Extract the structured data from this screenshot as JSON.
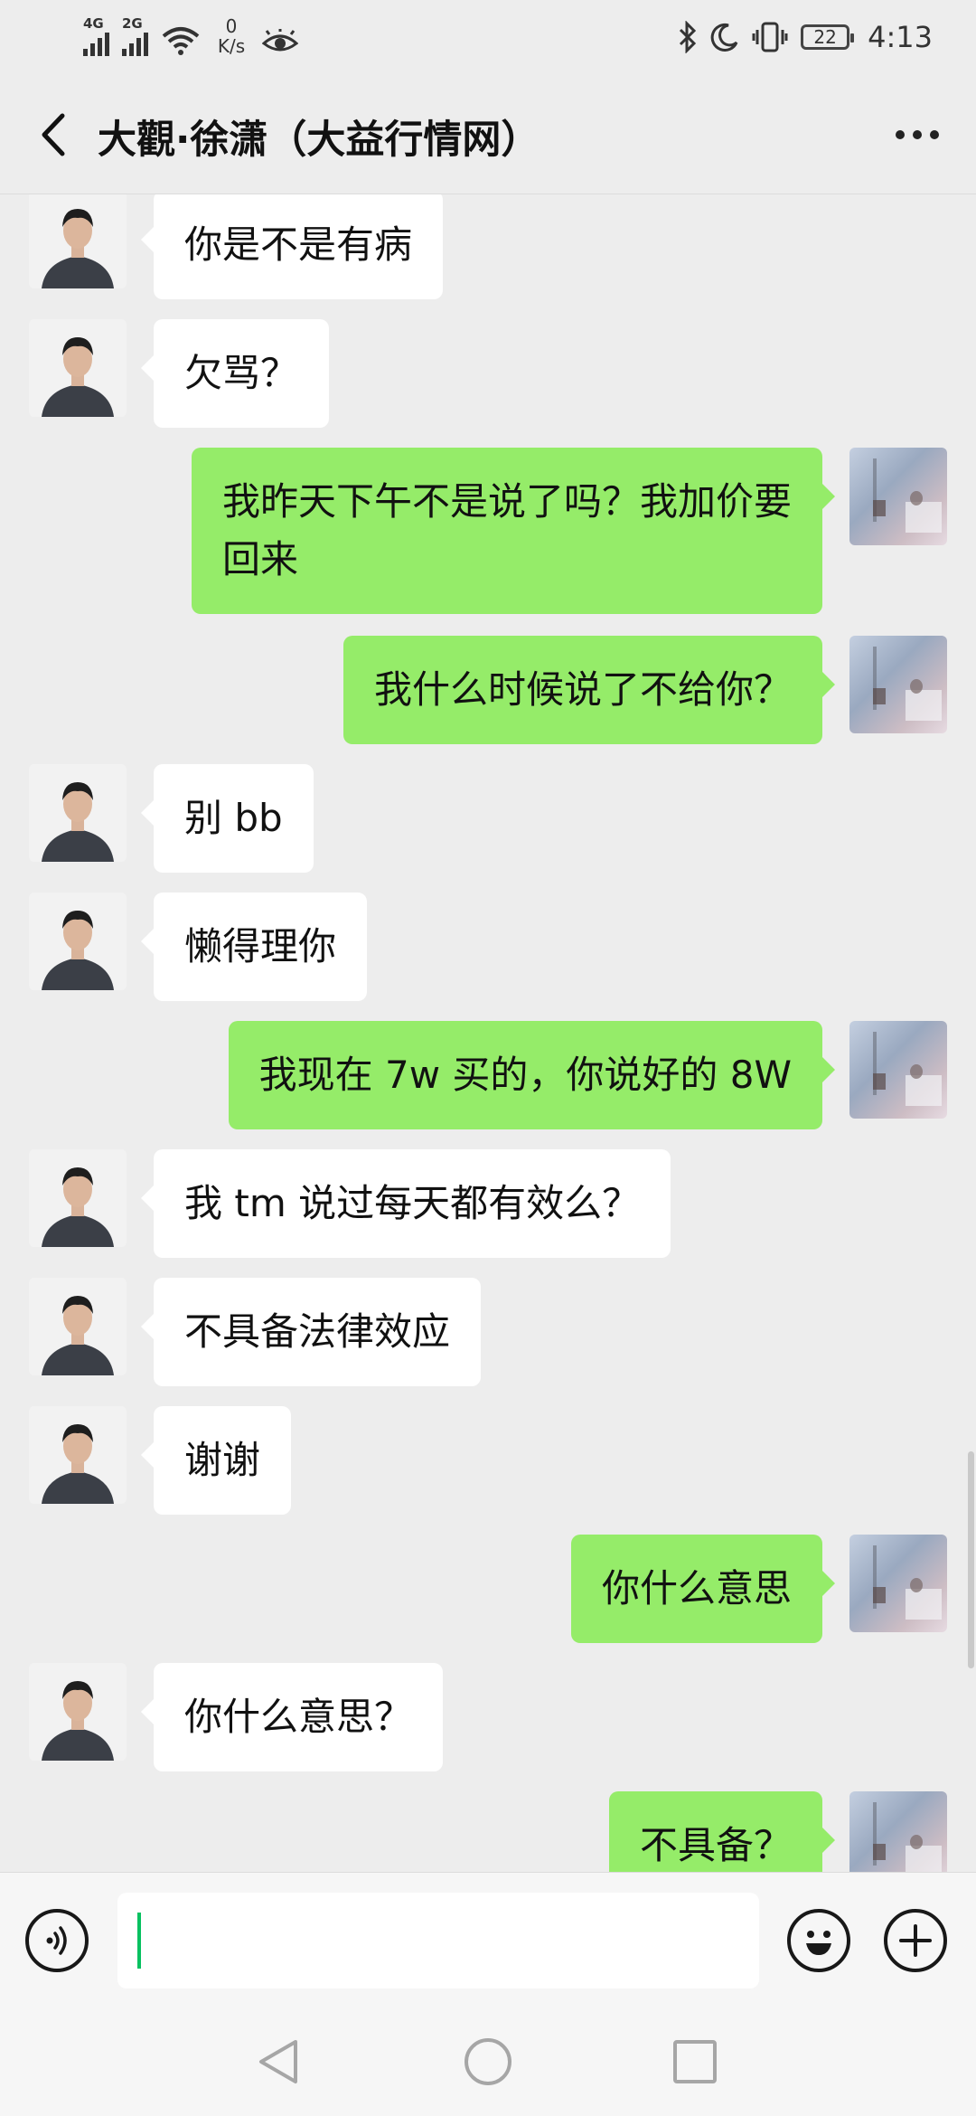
{
  "status_bar": {
    "signal_1_label": "4G",
    "signal_2_label": "2G",
    "net_speed_value": "0",
    "net_speed_unit": "K/s",
    "battery_level": "22",
    "time": "4:13"
  },
  "header": {
    "title": "大觀·徐潇（大益行情网）"
  },
  "messages": [
    {
      "side": "in",
      "text": "你是不是有病"
    },
    {
      "side": "in",
      "text": "欠骂？"
    },
    {
      "side": "out",
      "text": "我昨天下午不是说了吗？我加价要\n回来"
    },
    {
      "side": "out",
      "text": "我什么时候说了不给你？"
    },
    {
      "side": "in",
      "text": "别 bb"
    },
    {
      "side": "in",
      "text": "懒得理你"
    },
    {
      "side": "out",
      "text": "我现在 7w 买的，你说好的 8W"
    },
    {
      "side": "in",
      "text": "我 tm 说过每天都有效么？"
    },
    {
      "side": "in",
      "text": "不具备法律效应"
    },
    {
      "side": "in",
      "text": "谢谢"
    },
    {
      "side": "out",
      "text": "你什么意思"
    },
    {
      "side": "in",
      "text": "你什么意思？"
    },
    {
      "side": "out",
      "text": "不具备？"
    }
  ],
  "input": {
    "value": ""
  },
  "colors": {
    "background": "#ededed",
    "bubble_outgoing": "#95ec69",
    "bubble_incoming": "#ffffff",
    "caret": "#07c160"
  },
  "icons": [
    "back-arrow-icon",
    "more-dots-icon",
    "voice-icon",
    "emoji-icon",
    "plus-icon",
    "nav-back-icon",
    "nav-home-icon",
    "nav-recents-icon"
  ]
}
